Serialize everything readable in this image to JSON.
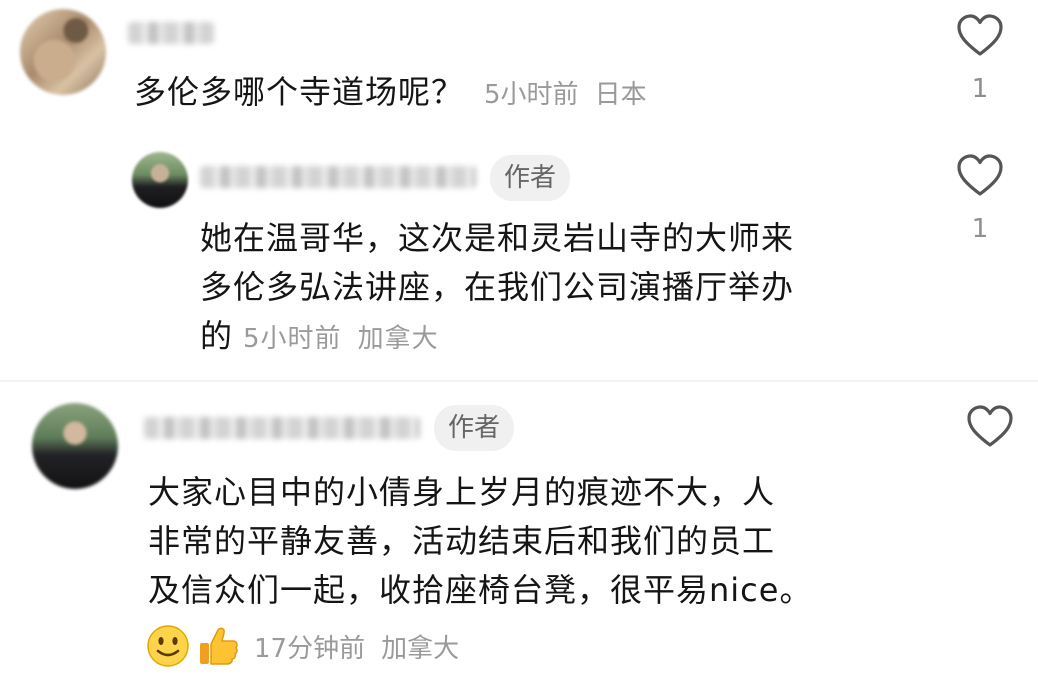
{
  "comments": [
    {
      "text": "多伦多哪个寺道场呢？",
      "time": "5小时前",
      "location": "日本",
      "likes": "1"
    },
    {
      "badge": "作者",
      "lines": [
        "她在温哥华，这次是和灵岩山寺的大师来",
        "多伦多弘法讲座，在我们公司演播厅举办",
        "的"
      ],
      "time": "5小时前",
      "location": "加拿大",
      "likes": "1"
    },
    {
      "badge": "作者",
      "lines": [
        "大家心目中的小倩身上岁月的痕迹不大，人",
        "非常的平静友善，活动结束后和我们的员工",
        "及信众们一起，收拾座椅台凳，很平易nice。"
      ],
      "time": "17分钟前",
      "location": "加拿大",
      "emojis": [
        "slightly-smiling-face",
        "thumbs-up"
      ]
    }
  ],
  "colors": {
    "text": "#151515",
    "meta": "#9a9a9a",
    "badge_bg": "#f0f0f0",
    "heart": "#555555"
  }
}
